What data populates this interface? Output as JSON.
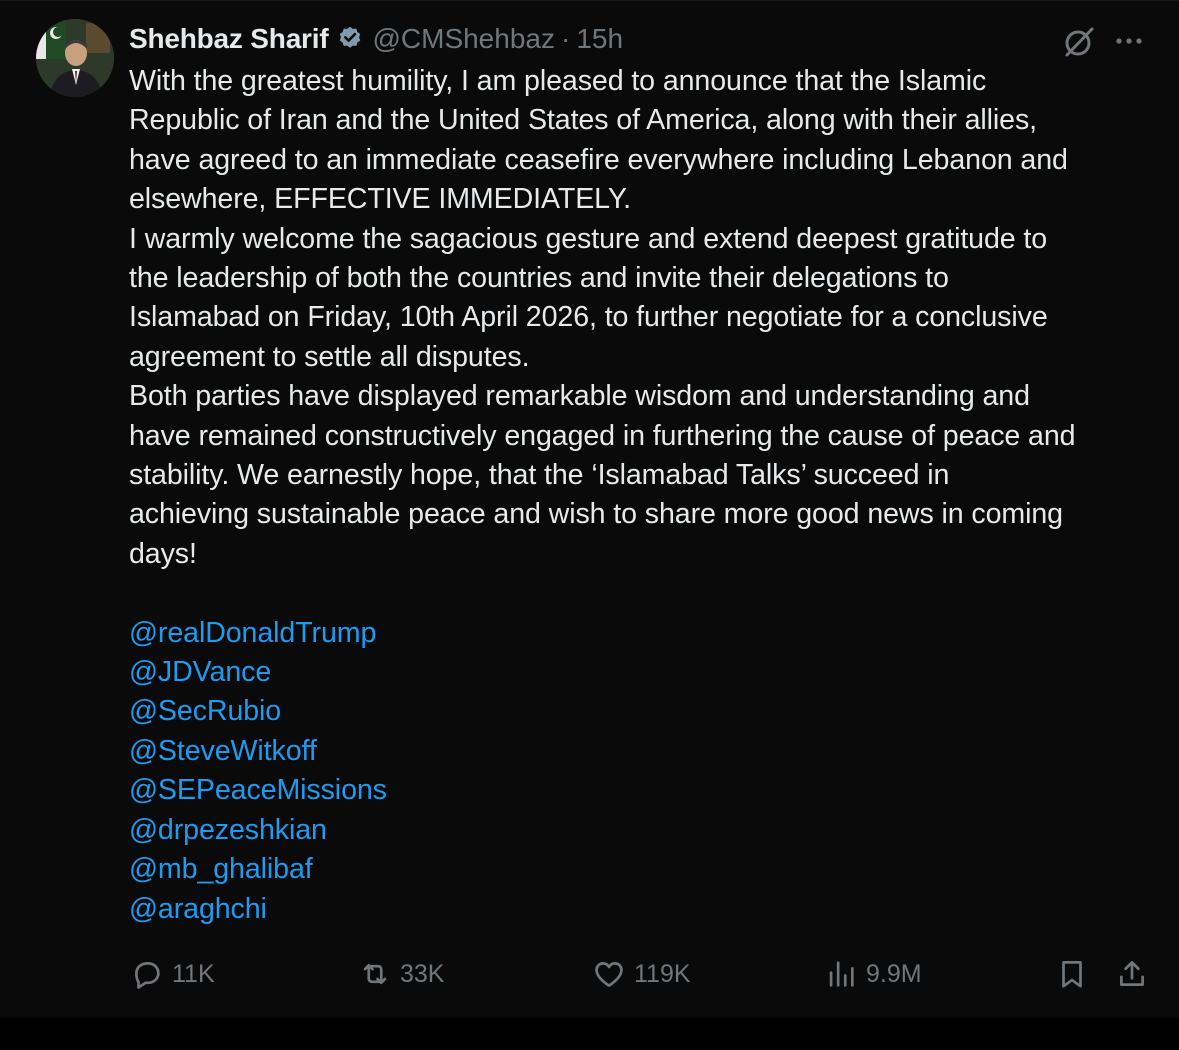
{
  "author": {
    "name": "Shehbaz Sharif",
    "handle": "@CMShehbaz",
    "separator": "·",
    "time": "15h",
    "verified_badge": "verified-badge-icon"
  },
  "tweet": {
    "lines": [
      "With the greatest humility, I am pleased to announce that the Islamic",
      "Republic of Iran and the United States of America, along with their allies,",
      "have agreed to an immediate ceasefire everywhere including Lebanon and",
      "elsewhere, EFFECTIVE IMMEDIATELY.",
      "I warmly welcome the sagacious gesture and extend deepest gratitude to",
      "the leadership of both the countries and invite their delegations to",
      "Islamabad on Friday, 10th April 2026, to further negotiate for a conclusive",
      "agreement to settle all disputes.",
      "Both parties have displayed remarkable wisdom and understanding and",
      "have remained constructively engaged in furthering the cause of peace and",
      "stability. We earnestly hope, that the ‘Islamabad Talks’ succeed in",
      "achieving sustainable peace and wish to share more good news in coming",
      "days!"
    ],
    "mentions": [
      "@realDonaldTrump",
      "@JDVance",
      "@SecRubio",
      "@SteveWitkoff",
      "@SEPeaceMissions",
      "@drpezeshkian",
      "@mb_ghalibaf",
      "@araghchi"
    ]
  },
  "actions": {
    "replies": "11K",
    "reposts": "33K",
    "likes": "119K",
    "views": "9.9M",
    "icons": [
      "reply-icon",
      "repost-icon",
      "like-icon",
      "views-icon",
      "bookmark-icon",
      "share-icon"
    ]
  },
  "colors": {
    "background": "#0a0a0a",
    "text": "#e7e9ea",
    "secondary": "#71767b",
    "accent": "#1d9bf0"
  }
}
